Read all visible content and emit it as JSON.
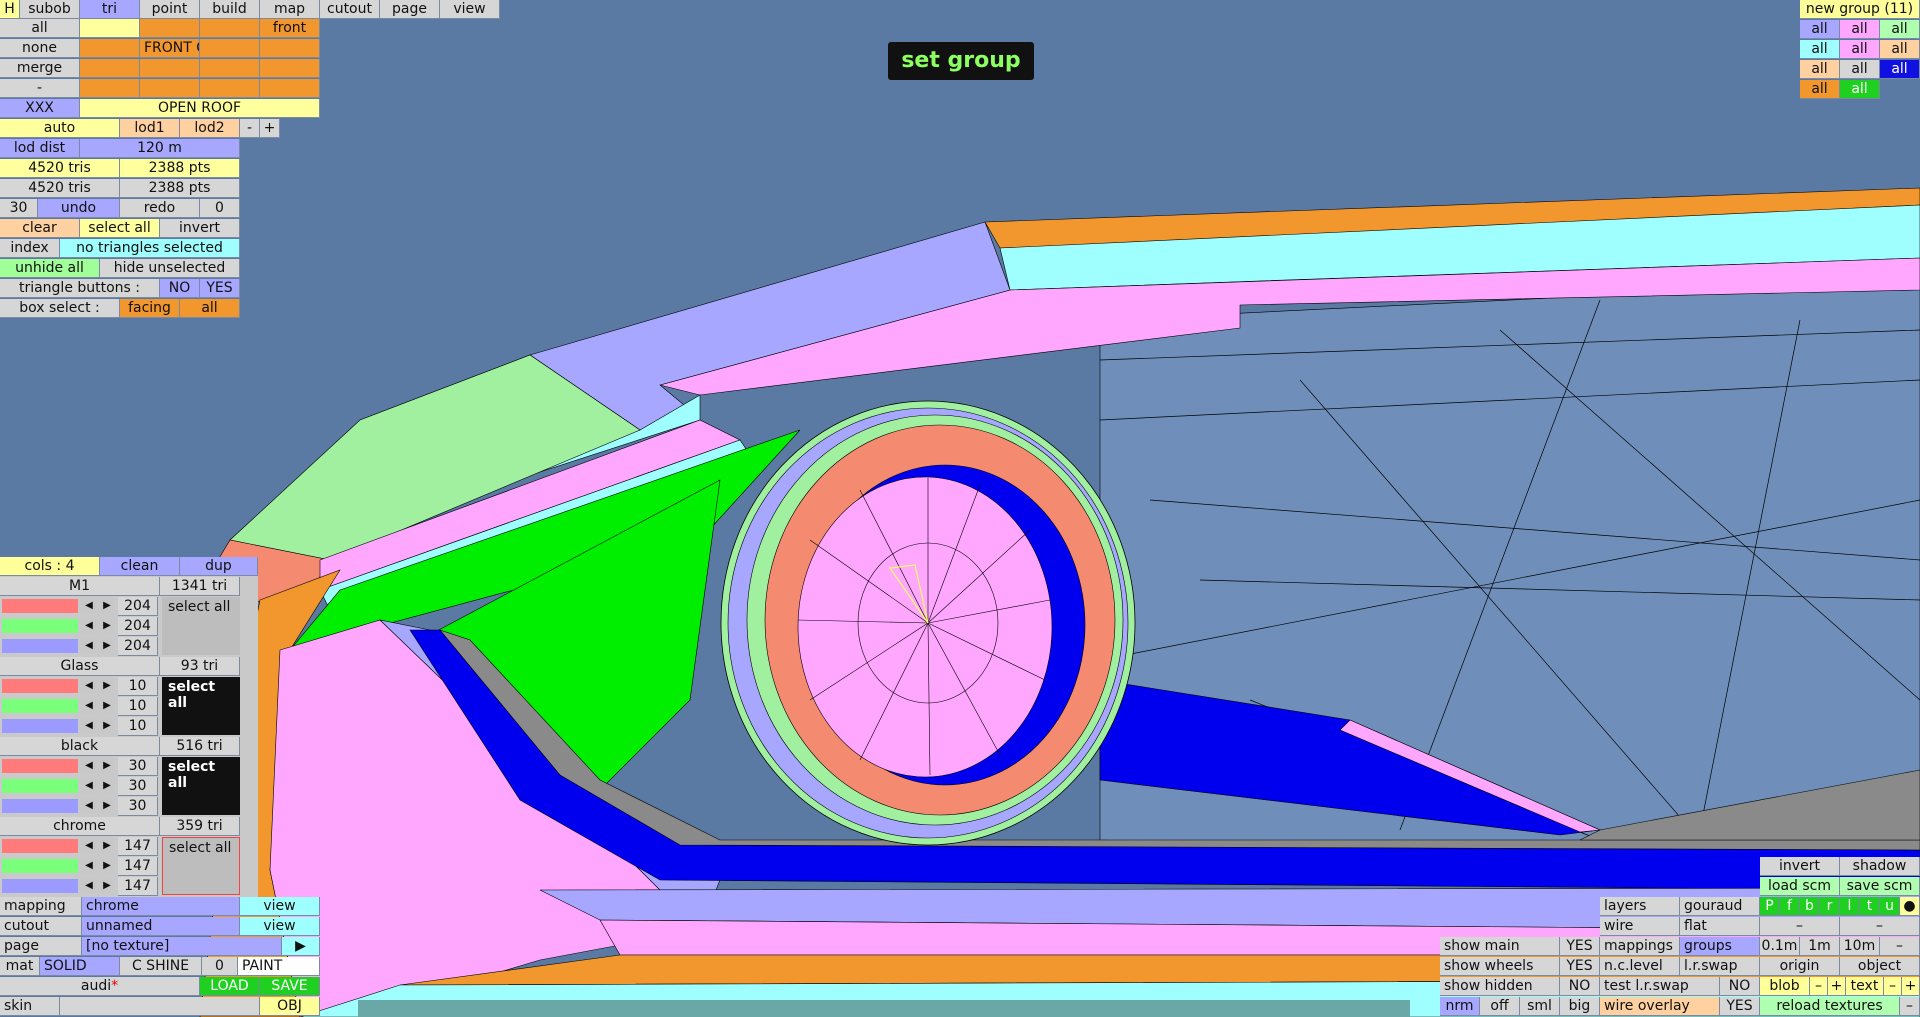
{
  "view": {
    "title": "set group"
  },
  "menu": {
    "items": [
      "H",
      "subob",
      "tri",
      "point",
      "build",
      "map",
      "cutout",
      "page",
      "view"
    ]
  },
  "groups_panel": {
    "rows": [
      [
        "all",
        "",
        "",
        "",
        "front"
      ],
      [
        "none",
        "",
        "FRONT G",
        "",
        ""
      ],
      [
        "merge",
        "",
        "",
        "",
        ""
      ],
      [
        "-",
        "",
        "",
        "",
        ""
      ],
      [
        "XXX",
        "",
        "OPEN ROOF",
        "",
        ""
      ]
    ]
  },
  "lod": {
    "auto": "auto",
    "lod1": "lod1",
    "lod2": "lod2",
    "minus": "-",
    "plus": "+"
  },
  "lod_dist": {
    "label": "lod dist",
    "value": "120 m"
  },
  "counts": [
    {
      "tris": "4520 tris",
      "pts": "2388 pts"
    },
    {
      "tris": "4520 tris",
      "pts": "2388 pts"
    }
  ],
  "undo_row": {
    "n": "30",
    "undo": "undo",
    "redo": "redo",
    "m": "0"
  },
  "select_row": {
    "clear": "clear",
    "select_all": "select all",
    "invert": "invert"
  },
  "index_row": {
    "index": "index",
    "status": "no triangles selected"
  },
  "hide_row": {
    "unhide": "unhide all",
    "hide": "hide unselected"
  },
  "tri_buttons": {
    "label": "triangle buttons :",
    "no": "NO",
    "yes": "YES"
  },
  "box_select": {
    "label": "box select :",
    "facing": "facing",
    "all": "all"
  },
  "right_groups": {
    "title": "new group (11)",
    "rows": [
      [
        "all",
        "all",
        "all"
      ],
      [
        "all",
        "all",
        "all"
      ],
      [
        "all",
        "all",
        "all"
      ],
      [
        "all",
        "all"
      ]
    ]
  },
  "materials": {
    "header": {
      "cols": "cols : 4",
      "clean": "clean",
      "dup": "dup"
    },
    "items": [
      {
        "name": "M1",
        "tris": "1341 tri",
        "vals": [
          "204",
          "204",
          "204"
        ],
        "action": "select all"
      },
      {
        "name": "Glass",
        "tris": "93 tri",
        "vals": [
          "10",
          "10",
          "10"
        ],
        "action": "select all"
      },
      {
        "name": "black",
        "tris": "516 tri",
        "vals": [
          "30",
          "30",
          "30"
        ],
        "action": "select all"
      },
      {
        "name": "chrome",
        "tris": "359 tri",
        "vals": [
          "147",
          "147",
          "147"
        ],
        "action": "select all"
      }
    ]
  },
  "bottom_left": {
    "mapping": {
      "label": "mapping",
      "value": "chrome",
      "view": "view"
    },
    "cutout": {
      "label": "cutout",
      "value": "unnamed",
      "view": "view"
    },
    "page": {
      "label": "page",
      "value": "[no texture]",
      "arrow": "▶"
    },
    "mat": {
      "label": "mat",
      "solid": "SOLID",
      "shine": "C SHINE",
      "num": "0",
      "paint": "PAINT"
    },
    "audi": {
      "name": "audi",
      "star": "*",
      "load": "LOAD",
      "save": "SAVE"
    },
    "skin": {
      "label": "skin",
      "obj": "OBJ"
    }
  },
  "bottom_right": {
    "invert": "invert",
    "shadow": "shadow",
    "load_scm": "load scm",
    "save_scm": "save scm",
    "layers": "layers",
    "gouraud": "gouraud",
    "pfbrltu": [
      "P",
      "f",
      "b",
      "r",
      "l",
      "t",
      "u",
      "●"
    ],
    "wire": "wire",
    "flat": "flat",
    "dash1": "–",
    "dash2": "–",
    "show_main": "show main",
    "show_main_v": "YES",
    "mappings": "mappings",
    "groups": "groups",
    "m01": "0.1m",
    "m1": "1m",
    "m10": "10m",
    "mdash": "–",
    "show_wheels": "show wheels",
    "show_wheels_v": "YES",
    "nclevel": "n.c.level",
    "lrswap": "l.r.swap",
    "origin": "origin",
    "object": "object",
    "show_hidden": "show hidden",
    "show_hidden_v": "NO",
    "test_lr": "test l.r.swap",
    "test_lr_v": "NO",
    "blob": "blob",
    "bminus": "–",
    "bplus": "+",
    "text": "text",
    "tminus": "–",
    "tplus": "+",
    "nrm": "nrm",
    "off": "off",
    "sml": "sml",
    "big": "big",
    "wire_overlay": "wire overlay",
    "wire_overlay_v": "YES",
    "reload": "reload textures",
    "rdash": "–"
  },
  "colors": {
    "bg": "#5a7aa3",
    "purple": "#a7a7ff",
    "cyan": "#9fffff",
    "pink": "#ffa6ff",
    "orange": "#f2962e",
    "green": "#00ee00",
    "blue": "#0000ee",
    "salmon": "#f48a70",
    "lightgreen": "#a0f0a0",
    "grey": "#8a8a8a"
  }
}
